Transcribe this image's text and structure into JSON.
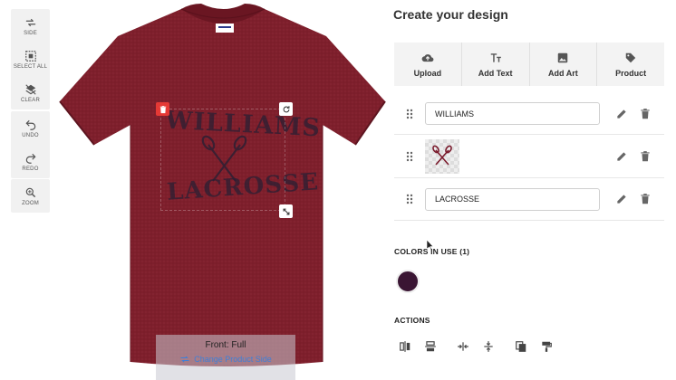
{
  "left_toolbar": {
    "tools": [
      {
        "label": "SIDE",
        "icon": "swap-side-icon"
      },
      {
        "label": "SELECT ALL",
        "icon": "select-all-icon"
      },
      {
        "label": "CLEAR",
        "icon": "clear-layers-icon"
      },
      {
        "label": "UNDO",
        "icon": "undo-icon"
      },
      {
        "label": "REDO",
        "icon": "redo-icon"
      },
      {
        "label": "ZOOM",
        "icon": "zoom-icon"
      }
    ]
  },
  "canvas": {
    "design_text_top": "WILLIAMS",
    "design_text_bottom": "LACROSSE",
    "side_title": "Front: Full",
    "side_link": "Change Product Side",
    "shirt_color": "#7e1f2c"
  },
  "panel": {
    "title": "Create your design",
    "tabs": [
      {
        "label": "Upload",
        "icon": "cloud-upload-icon"
      },
      {
        "label": "Add Text",
        "icon": "text-icon"
      },
      {
        "label": "Add Art",
        "icon": "image-icon"
      },
      {
        "label": "Product",
        "icon": "tag-icon"
      }
    ],
    "layers": [
      {
        "type": "text",
        "value": "WILLIAMS"
      },
      {
        "type": "art",
        "icon": "lacrosse-sticks-icon"
      },
      {
        "type": "text",
        "value": "LACROSSE"
      }
    ],
    "colors_label": "COLORS IN USE (1)",
    "colors": [
      "#3a1533"
    ],
    "actions_label": "ACTIONS",
    "actions": [
      "flip-horizontal-icon",
      "flip-vertical-icon",
      "center-horizontal-icon",
      "center-vertical-icon",
      "duplicate-icon",
      "format-paint-icon"
    ]
  }
}
